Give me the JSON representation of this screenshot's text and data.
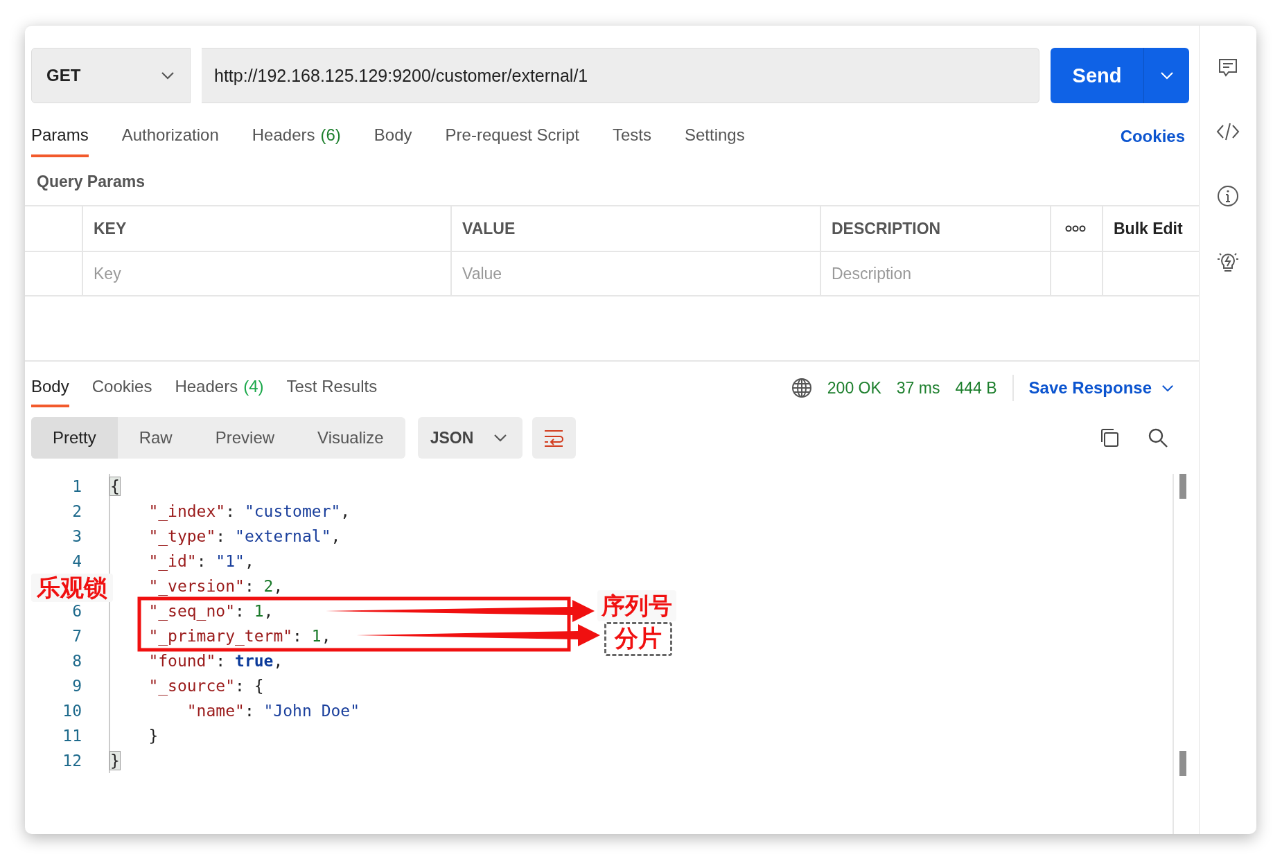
{
  "request": {
    "method": "GET",
    "url": "http://192.168.125.129:9200/customer/external/1",
    "send_label": "Send"
  },
  "request_tabs": [
    {
      "label": "Params",
      "selected": true
    },
    {
      "label": "Authorization",
      "selected": false
    },
    {
      "label": "Headers",
      "count": "(6)",
      "selected": false
    },
    {
      "label": "Body",
      "selected": false
    },
    {
      "label": "Pre-request Script",
      "selected": false
    },
    {
      "label": "Tests",
      "selected": false
    },
    {
      "label": "Settings",
      "selected": false
    }
  ],
  "cookies_link": "Cookies",
  "query_params": {
    "title": "Query Params",
    "columns": [
      "KEY",
      "VALUE",
      "DESCRIPTION"
    ],
    "bulk_edit": "Bulk Edit",
    "placeholders": [
      "Key",
      "Value",
      "Description"
    ]
  },
  "response_tabs": [
    {
      "label": "Body",
      "selected": true
    },
    {
      "label": "Cookies",
      "selected": false
    },
    {
      "label": "Headers",
      "count": "(4)",
      "selected": false
    },
    {
      "label": "Test Results",
      "selected": false
    }
  ],
  "status": {
    "code": "200 OK",
    "time": "37 ms",
    "size": "444 B",
    "save": "Save Response"
  },
  "view_modes": [
    {
      "label": "Pretty",
      "selected": true
    },
    {
      "label": "Raw",
      "selected": false
    },
    {
      "label": "Preview",
      "selected": false
    },
    {
      "label": "Visualize",
      "selected": false
    }
  ],
  "format": "JSON",
  "code_lines": [
    {
      "number": "1",
      "tokens": [
        {
          "kind": "match",
          "text": "{"
        }
      ]
    },
    {
      "number": "2",
      "tokens": [
        {
          "kind": "key",
          "text": "    \"_index\""
        },
        {
          "kind": "punct",
          "text": ": "
        },
        {
          "kind": "string",
          "text": "\"customer\""
        },
        {
          "kind": "punct",
          "text": ","
        }
      ]
    },
    {
      "number": "3",
      "tokens": [
        {
          "kind": "key",
          "text": "    \"_type\""
        },
        {
          "kind": "punct",
          "text": ": "
        },
        {
          "kind": "string",
          "text": "\"external\""
        },
        {
          "kind": "punct",
          "text": ","
        }
      ]
    },
    {
      "number": "4",
      "tokens": [
        {
          "kind": "key",
          "text": "    \"_id\""
        },
        {
          "kind": "punct",
          "text": ": "
        },
        {
          "kind": "string",
          "text": "\"1\""
        },
        {
          "kind": "punct",
          "text": ","
        }
      ]
    },
    {
      "tokens": [
        {
          "kind": "key",
          "text": "    \"_version\""
        },
        {
          "kind": "punct",
          "text": ": "
        },
        {
          "kind": "number",
          "text": "2"
        },
        {
          "kind": "punct",
          "text": ","
        }
      ]
    },
    {
      "number": "6",
      "tokens": [
        {
          "kind": "key",
          "text": "    \"_seq_no\""
        },
        {
          "kind": "punct",
          "text": ": "
        },
        {
          "kind": "number",
          "text": "1"
        },
        {
          "kind": "punct",
          "text": ","
        }
      ]
    },
    {
      "number": "7",
      "tokens": [
        {
          "kind": "key",
          "text": "    \"_primary_term\""
        },
        {
          "kind": "punct",
          "text": ": "
        },
        {
          "kind": "number",
          "text": "1"
        },
        {
          "kind": "punct",
          "text": ","
        }
      ]
    },
    {
      "number": "8",
      "tokens": [
        {
          "kind": "key",
          "text": "    \"found\""
        },
        {
          "kind": "punct",
          "text": ": "
        },
        {
          "kind": "bool",
          "text": "true"
        },
        {
          "kind": "punct",
          "text": ","
        }
      ]
    },
    {
      "number": "9",
      "tokens": [
        {
          "kind": "key",
          "text": "    \"_source\""
        },
        {
          "kind": "punct",
          "text": ": {"
        }
      ]
    },
    {
      "number": "10",
      "tokens": [
        {
          "kind": "key",
          "text": "        \"name\""
        },
        {
          "kind": "punct",
          "text": ": "
        },
        {
          "kind": "string",
          "text": "\"John Doe\""
        }
      ]
    },
    {
      "number": "11",
      "tokens": [
        {
          "kind": "punct",
          "text": "    }"
        }
      ]
    },
    {
      "number": "12",
      "tokens": [
        {
          "kind": "match",
          "text": "}"
        }
      ]
    }
  ],
  "annotations": {
    "left_label": "乐观锁",
    "seq_label": "序列号",
    "shard_label": "分片"
  }
}
